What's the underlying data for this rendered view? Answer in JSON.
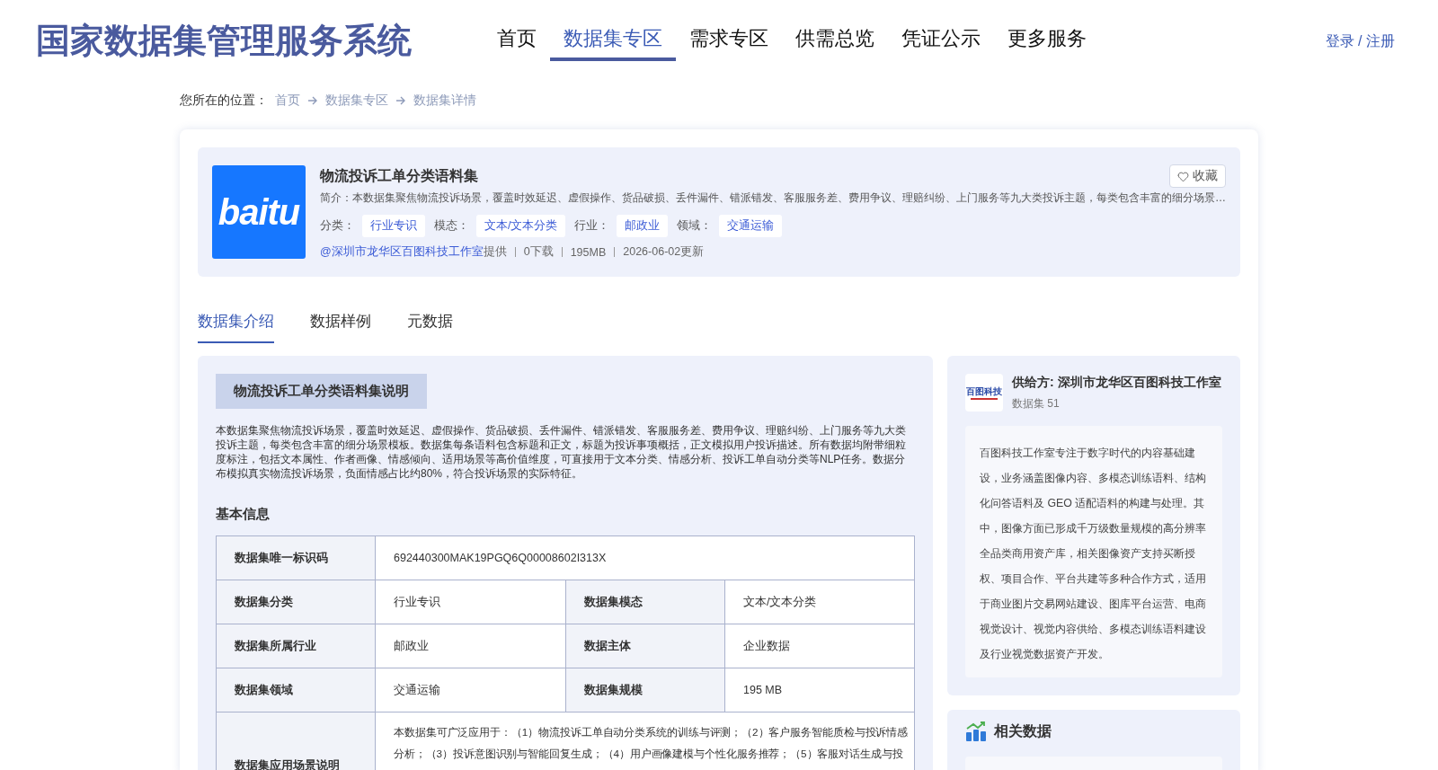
{
  "header": {
    "title": "国家数据集管理服务系统",
    "nav": [
      {
        "label": "首页",
        "selected": false
      },
      {
        "label": "数据集专区",
        "selected": true
      },
      {
        "label": "需求专区",
        "selected": false
      },
      {
        "label": "供需总览",
        "selected": false
      },
      {
        "label": "凭证公示",
        "selected": false
      },
      {
        "label": "更多服务",
        "selected": false
      }
    ],
    "auth": "登录 / 注册"
  },
  "breadcrumb": {
    "prefix": "您所在的位置：",
    "items": [
      "首页",
      "数据集专区",
      "数据集详情"
    ]
  },
  "dataset": {
    "logo_text": "baitu",
    "name": "物流投诉工单分类语料集",
    "favorite": "收藏",
    "summary": "简介：本数据集聚焦物流投诉场景，覆盖时效延迟、虚假操作、货品破损、丢件漏件、错派错发、客服服务差、费用争议、理赔纠纷、上门服务等九大类投诉主题，每类包含丰富的细分场景…",
    "tags": [
      {
        "label": "分类：",
        "value": "行业专识"
      },
      {
        "label": "模态：",
        "value": "文本/文本分类"
      },
      {
        "label": "行业：",
        "value": "邮政业"
      },
      {
        "label": "领域：",
        "value": "交通运输"
      }
    ],
    "provider": "@深圳市龙华区百图科技工作室",
    "provider_suffix": "提供",
    "meta": [
      "0下载",
      "195MB",
      "2026-06-02更新"
    ]
  },
  "tabs": [
    {
      "label": "数据集介绍",
      "selected": true
    },
    {
      "label": "数据样例",
      "selected": false
    },
    {
      "label": "元数据",
      "selected": false
    }
  ],
  "description": {
    "title": "物流投诉工单分类语料集说明",
    "text": "本数据集聚焦物流投诉场景，覆盖时效延迟、虚假操作、货品破损、丢件漏件、错派错发、客服服务差、费用争议、理赔纠纷、上门服务等九大类投诉主题，每类包含丰富的细分场景模板。数据集每条语料包含标题和正文，标题为投诉事项概括，正文模拟用户投诉描述。所有数据均附带细粒度标注，包括文本属性、作者画像、情感倾向、适用场景等高价值维度，可直接用于文本分类、情感分析、投诉工单自动分类等NLP任务。数据分布模拟真实物流投诉场景，负面情感占比约80%，符合投诉场景的实际特征。"
  },
  "basic_info": {
    "title": "基本信息",
    "rows": [
      [
        {
          "label": "数据集唯一标识码",
          "value": "692440300MAK19PGQ6Q00008602I313X"
        }
      ],
      [
        {
          "label": "数据集分类",
          "value": "行业专识"
        },
        {
          "label": "数据集模态",
          "value": "文本/文本分类"
        }
      ],
      [
        {
          "label": "数据集所属行业",
          "value": "邮政业"
        },
        {
          "label": "数据主体",
          "value": "企业数据"
        }
      ],
      [
        {
          "label": "数据集领域",
          "value": "交通运输"
        },
        {
          "label": "数据集规模",
          "value": "195 MB"
        }
      ],
      [
        {
          "label": "数据集应用场景说明",
          "value": "本数据集可广泛应用于：（1）物流投诉工单自动分类系统的训练与评测；（2）客户服务智能质检与投诉情感分析；（3）投诉意图识别与智能回复生成；（4）用户画像建模与个性化服务推荐；（5）客服对话生成与投"
        }
      ]
    ]
  },
  "supplier": {
    "logo_text": "百图科技",
    "name": "供给方: 深圳市龙华区百图科技工作室",
    "count": "数据集 51",
    "about": "百图科技工作室专注于数字时代的内容基础建设，业务涵盖图像内容、多模态训练语料、结构化问答语料及 GEO 适配语料的构建与处理。其中，图像方面已形成千万级数量规模的高分辨率全品类商用资产库，相关图像资产支持买断授权、项目合作、平台共建等多种合作方式，适用于商业图片交易网站建设、图库平台运营、电商视觉设计、视觉内容供给、多模态训练语料建设及行业视觉数据资产开发。"
  },
  "related": {
    "title": "相关数据"
  }
}
